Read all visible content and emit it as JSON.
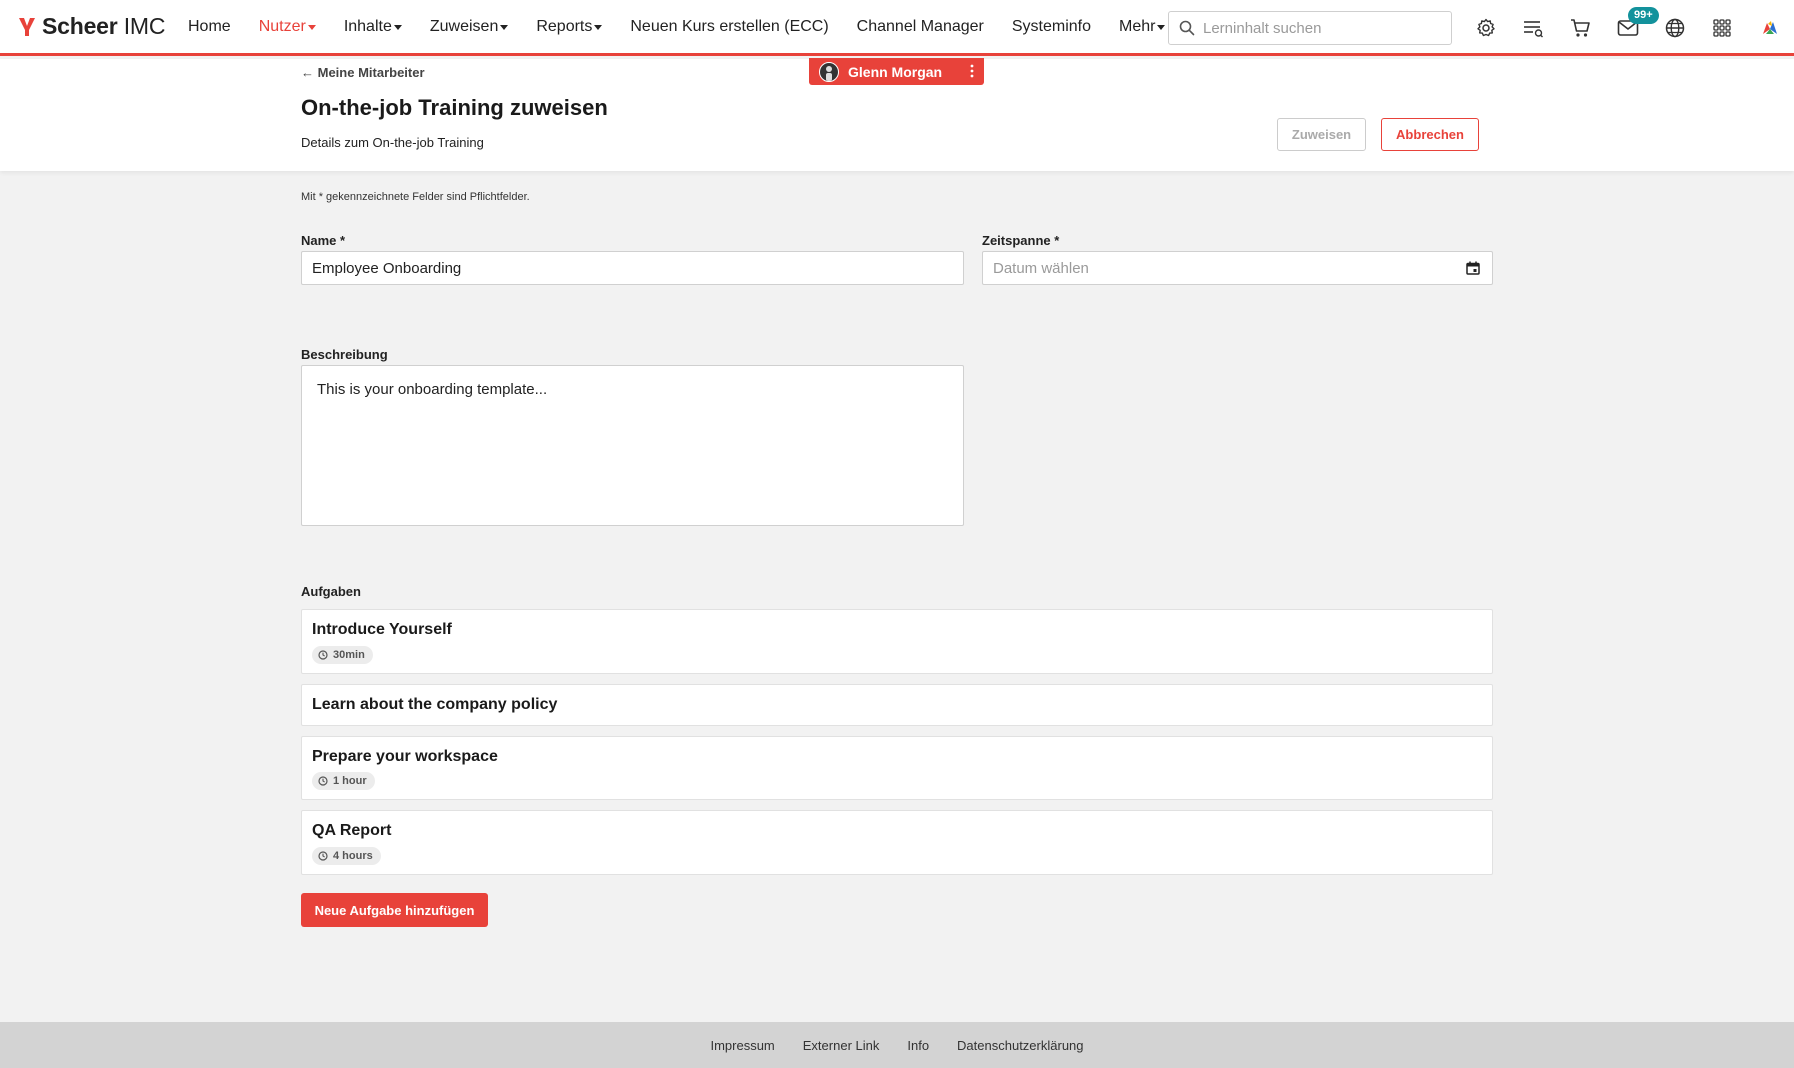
{
  "brand": {
    "name_bold": "Scheer",
    "name_regular": "IMC",
    "accent": "#e8423a"
  },
  "nav": {
    "items": [
      {
        "label": "Home",
        "dropdown": false,
        "active": false
      },
      {
        "label": "Nutzer",
        "dropdown": true,
        "active": true
      },
      {
        "label": "Inhalte",
        "dropdown": true,
        "active": false
      },
      {
        "label": "Zuweisen",
        "dropdown": true,
        "active": false
      },
      {
        "label": "Reports",
        "dropdown": true,
        "active": false
      },
      {
        "label": "Neuen Kurs erstellen (ECC)",
        "dropdown": false,
        "active": false
      },
      {
        "label": "Channel Manager",
        "dropdown": false,
        "active": false
      },
      {
        "label": "Systeminfo",
        "dropdown": false,
        "active": false
      },
      {
        "label": "Mehr",
        "dropdown": true,
        "active": false
      }
    ]
  },
  "search": {
    "placeholder": "Lerninhalt suchen",
    "value": ""
  },
  "toolbar": {
    "icons": [
      "gear-icon",
      "task-list-icon",
      "cart-icon",
      "mail-icon",
      "globe-icon",
      "apps-grid-icon",
      "colorful-logo-icon"
    ],
    "mail_badge": "99+",
    "badge_color": "#13929c"
  },
  "impersonation": {
    "user_name": "Glenn Morgan"
  },
  "header": {
    "back_label": "← Meine Mitarbeiter",
    "title": "On-the-job Training zuweisen",
    "subtitle": "Details zum On-the-job Training",
    "assign_label": "Zuweisen",
    "cancel_label": "Abbrechen"
  },
  "form": {
    "required_note": "Mit * gekennzeichnete Felder sind Pflichtfelder.",
    "name_label": "Name *",
    "name_value": "Employee Onboarding",
    "period_label": "Zeitspanne *",
    "period_placeholder": "Datum wählen",
    "description_label": "Beschreibung",
    "description_value": "This is your onboarding template..."
  },
  "tasks": {
    "label": "Aufgaben",
    "items": [
      {
        "title": "Introduce Yourself",
        "duration": "30min"
      },
      {
        "title": "Learn about the company policy",
        "duration": ""
      },
      {
        "title": "Prepare your workspace",
        "duration": "1 hour"
      },
      {
        "title": "QA Report",
        "duration": "4 hours"
      }
    ],
    "add_label": "Neue Aufgabe hinzufügen"
  },
  "footer": {
    "links": [
      "Impressum",
      "Externer Link",
      "Info",
      "Datenschutzerklärung"
    ]
  }
}
